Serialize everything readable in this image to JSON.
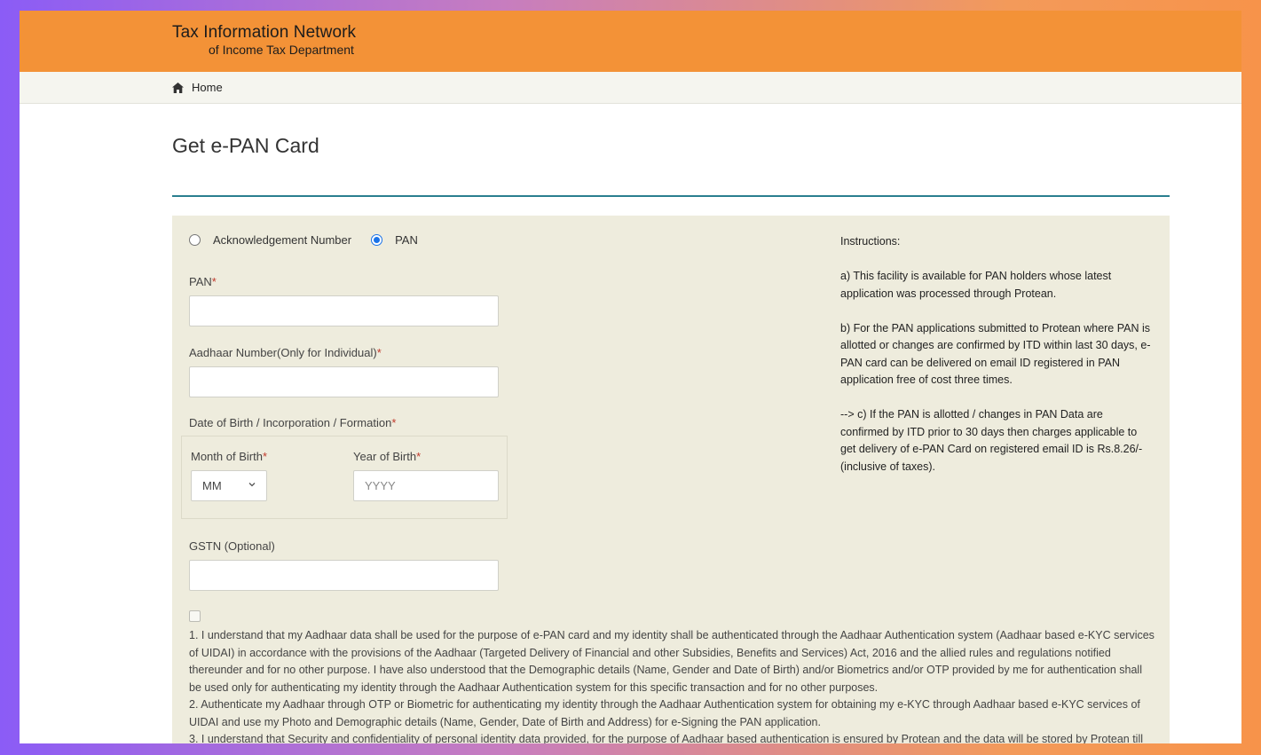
{
  "header": {
    "brand_line1": "Tax Information Network",
    "brand_line2": "of Income Tax Department"
  },
  "breadcrumb": {
    "home_label": "Home",
    "icon": "home-icon"
  },
  "page": {
    "title": "Get e-PAN Card"
  },
  "form": {
    "radio_options": [
      {
        "label": "Acknowledgement Number",
        "selected": false
      },
      {
        "label": "PAN",
        "selected": true
      }
    ],
    "pan_label": "PAN",
    "pan_value": "",
    "aadhaar_label": "Aadhaar Number(Only for Individual)",
    "aadhaar_value": "",
    "dob_label": "Date of Birth / Incorporation / Formation",
    "month_label": "Month of Birth",
    "month_value": "MM",
    "year_label": "Year of Birth",
    "year_placeholder": "YYYY",
    "gstn_label": "GSTN (Optional)",
    "gstn_value": "",
    "required_mark": "*",
    "consent_checked": false,
    "terms": [
      "1. I understand that my Aadhaar data shall be used for the purpose of e-PAN card and my identity shall be authenticated through the Aadhaar Authentication system (Aadhaar based e-KYC services of UIDAI) in accordance with the provisions of the Aadhaar (Targeted Delivery of Financial and other Subsidies, Benefits and Services) Act, 2016 and the allied rules and regulations notified thereunder and for no other purpose. I have also understood that the Demographic details (Name, Gender and Date of Birth) and/or Biometrics and/or OTP provided by me for authentication shall be used only for authenticating my identity through the Aadhaar Authentication system for this specific transaction and for no other purposes.",
      "2. Authenticate my Aadhaar through OTP or Biometric for authenticating my identity through the Aadhaar Authentication system for obtaining my e-KYC through Aadhaar based e-KYC services of UIDAI and use my Photo and Demographic details (Name, Gender, Date of Birth and Address) for e-Signing the PAN application.",
      "3. I understand that Security and confidentiality of personal identity data provided, for the purpose of Aadhaar based authentication is ensured by Protean and the data will be stored by Protean till"
    ]
  },
  "instructions": {
    "heading": "Instructions:",
    "items": [
      "a) This facility is available for PAN holders whose latest application was processed through Protean.",
      "b) For the PAN applications submitted to Protean where PAN is allotted or changes are confirmed by ITD within last 30 days, e-PAN card can be delivered on email ID registered in PAN application free of cost three times.",
      "--> c) If the PAN is allotted / changes in PAN Data are confirmed by ITD prior to 30 days then charges applicable to get delivery of e-PAN Card on registered email ID is Rs.8.26/- (inclusive of taxes)."
    ]
  },
  "colors": {
    "header_bg": "#f39237",
    "panel_bg": "#eeecdd",
    "accent_rule": "#2a7f8f",
    "radio_selected": "#1a73e8"
  }
}
